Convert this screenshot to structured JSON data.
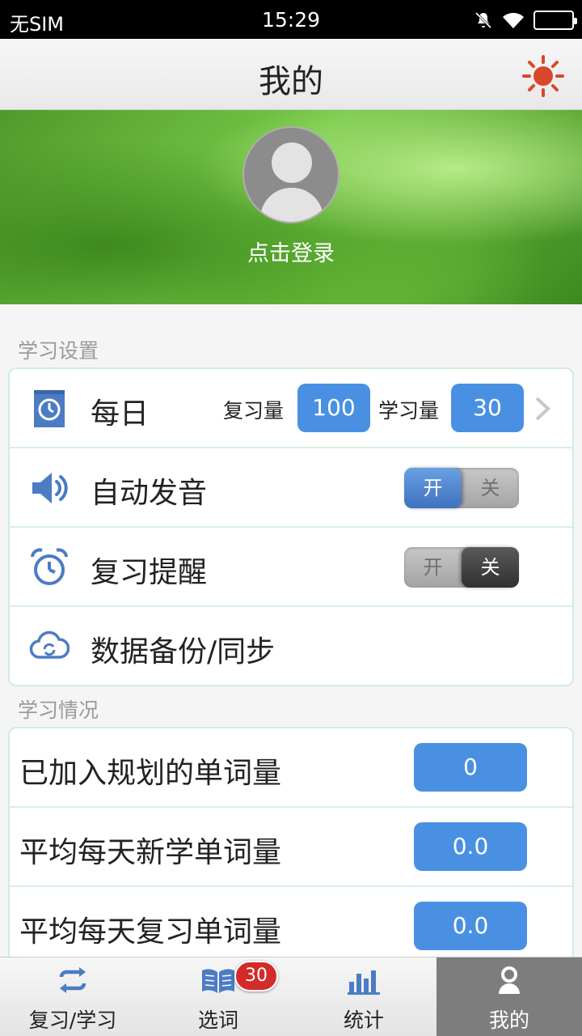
{
  "status_bar": {
    "carrier": "无SIM",
    "time": "15:29"
  },
  "header": {
    "title": "我的",
    "settings_icon": "sun-icon"
  },
  "profile": {
    "login_text": "点击登录"
  },
  "study_settings": {
    "section_label": "学习设置",
    "daily": {
      "label": "每日",
      "review_label": "复习量",
      "review_value": "100",
      "learn_label": "学习量",
      "learn_value": "30"
    },
    "auto_pronounce": {
      "label": "自动发音",
      "on_label": "开",
      "off_label": "关",
      "state": "on"
    },
    "review_reminder": {
      "label": "复习提醒",
      "on_label": "开",
      "off_label": "关",
      "state": "off"
    },
    "backup": {
      "label": "数据备份/同步"
    }
  },
  "study_status": {
    "section_label": "学习情况",
    "rows": [
      {
        "label": "已加入规划的单词量",
        "value": "0"
      },
      {
        "label": "平均每天新学单词量",
        "value": "0.0"
      },
      {
        "label": "平均每天复习单词量",
        "value": "0.0"
      }
    ]
  },
  "bottom_nav": {
    "items": [
      {
        "label": "复习/学习",
        "icon": "repeat-icon"
      },
      {
        "label": "选词",
        "icon": "book-icon",
        "badge": "30"
      },
      {
        "label": "统计",
        "icon": "bar-chart-icon"
      },
      {
        "label": "我的",
        "icon": "person-icon"
      }
    ],
    "active_index": 3
  },
  "colors": {
    "accent_blue": "#4a90e2",
    "badge_red": "#d32a2a",
    "card_border": "#cfeedd"
  }
}
